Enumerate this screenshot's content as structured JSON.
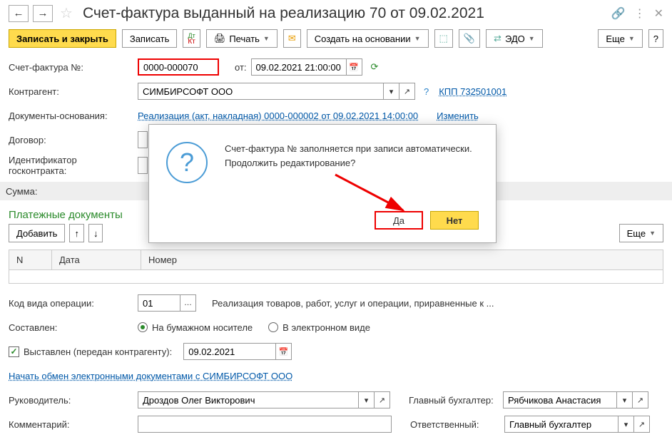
{
  "header": {
    "title": "Счет-фактура выданный на реализацию 70 от 09.02.2021"
  },
  "toolbar": {
    "save_close": "Записать и закрыть",
    "save": "Записать",
    "print": "Печать",
    "create_based": "Создать на основании",
    "edo": "ЭДО",
    "more": "Еще",
    "help": "?",
    "more2": "Еще"
  },
  "form": {
    "invoice_no_label": "Счет-фактура №:",
    "invoice_no": "0000-000070",
    "from_label": "от:",
    "date": "09.02.2021 21:00:00",
    "counterparty_label": "Контрагент:",
    "counterparty": "СИМБИРСОФТ ООО",
    "kpp": "КПП 732501001",
    "basis_label": "Документы-основания:",
    "basis_link": "Реализация (акт, накладная) 0000-000002 от 09.02.2021 14:00:00",
    "change_link": "Изменить",
    "contract_label": "Договор:",
    "gov_contract_label": "Идентификатор госконтракта:",
    "sum_label": "Сумма:",
    "payment_docs_title": "Платежные документы",
    "add": "Добавить",
    "op_code_label": "Код вида операции:",
    "op_code": "01",
    "op_desc": "Реализация товаров, работ, услуг и операции, приравненные к ...",
    "composed_label": "Составлен:",
    "paper": "На бумажном носителе",
    "electronic": "В электронном виде",
    "issued_label": "Выставлен (передан контрагенту):",
    "issued_date": "09.02.2021",
    "exchange_link": "Начать обмен электронными документами с СИМБИРСОФТ ООО",
    "manager_label": "Руководитель:",
    "manager": "Дроздов Олег Викторович",
    "chief_acc_label": "Главный бухгалтер:",
    "chief_acc": "Рябчикова Анастасия",
    "comment_label": "Комментарий:",
    "responsible_label": "Ответственный:",
    "responsible": "Главный бухгалтер"
  },
  "table": {
    "col_n": "N",
    "col_date": "Дата",
    "col_number": "Номер"
  },
  "dialog": {
    "line1": "Счет-фактура № заполняется при записи автоматически.",
    "line2": "Продолжить редактирование?",
    "yes": "Да",
    "no": "Нет"
  }
}
